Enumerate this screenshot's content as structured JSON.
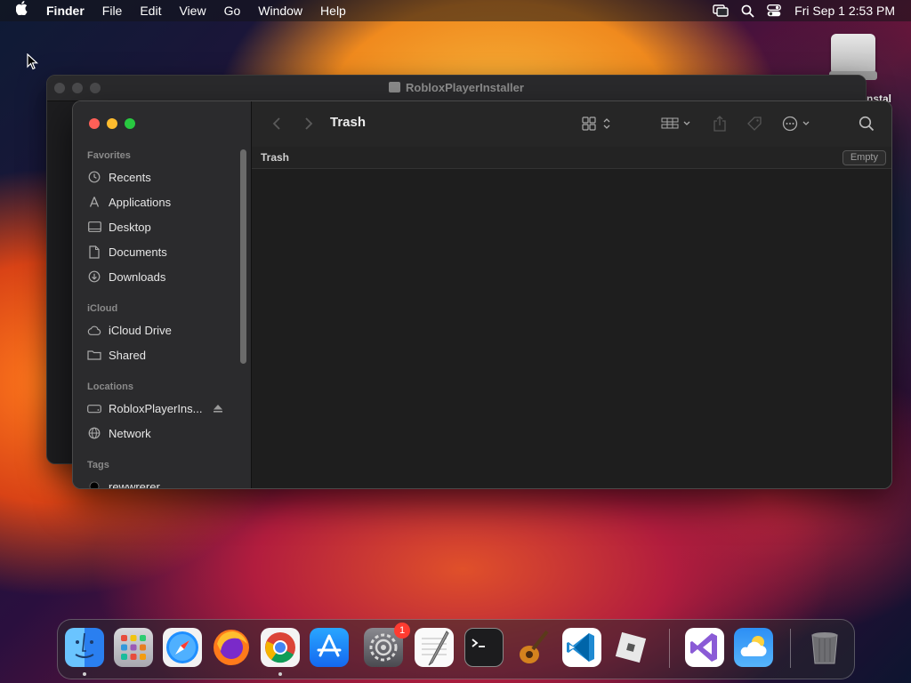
{
  "menubar": {
    "apple_icon": "apple-icon",
    "app_name": "Finder",
    "menus": [
      "File",
      "Edit",
      "View",
      "Go",
      "Window",
      "Help"
    ],
    "clock": "Fri Sep 1  2:53 PM"
  },
  "desktop": {
    "disk_label": "rInstal"
  },
  "background_window": {
    "title": "RobloxPlayerInstaller"
  },
  "finder": {
    "title": "Trash",
    "sidebar": {
      "favorites_header": "Favorites",
      "favorites": [
        {
          "label": "Recents",
          "icon": "clock-icon"
        },
        {
          "label": "Applications",
          "icon": "applications-icon"
        },
        {
          "label": "Desktop",
          "icon": "desktop-icon"
        },
        {
          "label": "Documents",
          "icon": "document-icon"
        },
        {
          "label": "Downloads",
          "icon": "download-icon"
        }
      ],
      "icloud_header": "iCloud",
      "icloud": [
        {
          "label": "iCloud Drive",
          "icon": "cloud-icon"
        },
        {
          "label": "Shared",
          "icon": "shared-folder-icon"
        }
      ],
      "locations_header": "Locations",
      "locations": [
        {
          "label": "RobloxPlayerIns...",
          "icon": "drive-icon"
        },
        {
          "label": "Network",
          "icon": "globe-icon"
        }
      ],
      "tags_header": "Tags",
      "tags": [
        {
          "label": "rewwrerer",
          "icon": "tag-dot-icon"
        }
      ]
    },
    "pathbar_label": "Trash",
    "empty_button": "Empty"
  },
  "dock": {
    "apps": [
      "Finder",
      "Launchpad",
      "Safari",
      "Firefox",
      "Chrome",
      "App Store",
      "System Settings",
      "TextEdit",
      "Terminal",
      "GarageBand",
      "Visual Studio Code",
      "Roblox",
      "Visual Studio",
      "Weather",
      "Trash"
    ],
    "settings_badge": "1"
  },
  "colors": {
    "close": "#fe5f57",
    "minimize": "#febc2e",
    "zoom": "#28c840",
    "badge": "#ff3b30"
  }
}
